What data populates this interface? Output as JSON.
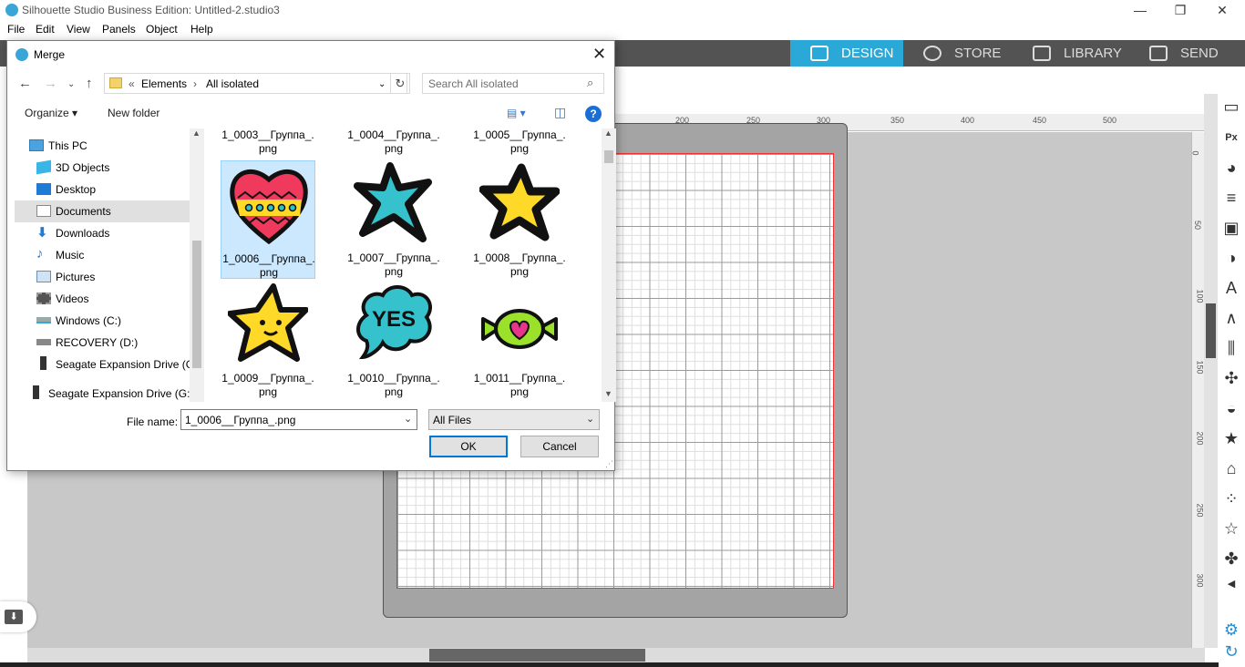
{
  "window": {
    "title": "Silhouette Studio Business Edition: Untitled-2.studio3"
  },
  "menu": [
    "File",
    "Edit",
    "View",
    "Panels",
    "Object",
    "Help"
  ],
  "nav_tabs": [
    {
      "label": "DESIGN",
      "active": true
    },
    {
      "label": "STORE"
    },
    {
      "label": "LIBRARY"
    },
    {
      "label": "SEND"
    }
  ],
  "ruler": {
    "top_ticks": [
      "200",
      "250",
      "300",
      "350",
      "400",
      "450",
      "500"
    ],
    "right_ticks": [
      "0",
      "50",
      "100",
      "150",
      "200",
      "250",
      "300"
    ]
  },
  "dialog": {
    "title": "Merge",
    "breadcrumb": [
      "«",
      "Elements",
      "›",
      "All isolated"
    ],
    "search_placeholder": "Search All isolated",
    "organize_label": "Organize ▾",
    "new_folder_label": "New folder",
    "help_label": "?",
    "nav_items": [
      {
        "label": "This PC",
        "icon": "pc-icon"
      },
      {
        "label": "3D Objects",
        "icon": "cube-icon"
      },
      {
        "label": "Desktop",
        "icon": "desktop-icon"
      },
      {
        "label": "Documents",
        "icon": "document-icon",
        "selected": true
      },
      {
        "label": "Downloads",
        "icon": "download-icon"
      },
      {
        "label": "Music",
        "icon": "music-icon"
      },
      {
        "label": "Pictures",
        "icon": "pictures-icon"
      },
      {
        "label": "Videos",
        "icon": "video-icon"
      },
      {
        "label": "Windows (C:)",
        "icon": "drive-icon"
      },
      {
        "label": "RECOVERY (D:)",
        "icon": "drive-icon"
      },
      {
        "label": "Seagate Expansion Drive (G:",
        "icon": "external-drive-icon"
      },
      {
        "label": "Seagate Expansion Drive (G:)",
        "icon": "external-drive-icon"
      }
    ],
    "files_top": [
      {
        "name": "1_0003__Группа_.\npng"
      },
      {
        "name": "1_0004__Группа_.\npng"
      },
      {
        "name": "1_0005__Группа_.\npng"
      }
    ],
    "files": [
      {
        "name": "1_0006__Группа_.\npng",
        "icon": "heart-sticker-icon",
        "selected": true
      },
      {
        "name": "1_0007__Группа_.\npng",
        "icon": "teal-star-sticker-icon"
      },
      {
        "name": "1_0008__Группа_.\npng",
        "icon": "yellow-star-sticker-icon"
      },
      {
        "name": "1_0009__Группа_.\npng",
        "icon": "smiling-star-sticker-icon"
      },
      {
        "name": "1_0010__Группа_.\npng",
        "icon": "yes-bubble-sticker-icon"
      },
      {
        "name": "1_0011__Группа_.\npng",
        "icon": "candy-sticker-icon"
      }
    ],
    "filename_label": "File name:",
    "filename_value": "1_0006__Группа_.png",
    "filter_value": "All Files",
    "ok_label": "OK",
    "cancel_label": "Cancel"
  },
  "colors": {
    "accent": "#2aa8d8",
    "nav_bg": "#535353",
    "canvas_bg": "#c8c8c8",
    "selection": "#cce8ff",
    "arrow": "#ee1c1c"
  }
}
